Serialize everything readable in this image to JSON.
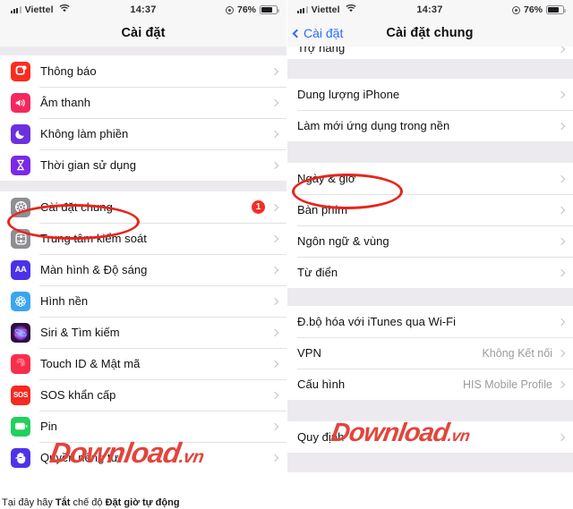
{
  "status_bar": {
    "carrier": "Viettel",
    "time": "14:37",
    "battery_percent": "76%",
    "wifi_icon": "wifi-icon",
    "signal_icon": "signal-bars-icon",
    "lock_icon": "rotation-lock-icon",
    "battery_icon": "battery-icon"
  },
  "left_phone": {
    "nav": {
      "title": "Cài đặt"
    },
    "groups": [
      {
        "rows": [
          {
            "label": "Thông báo",
            "icon": "notifications-icon",
            "icon_color": "#fb2c1f",
            "glyph": "notif"
          },
          {
            "label": "Âm thanh",
            "icon": "sounds-icon",
            "icon_color": "#f4285e",
            "glyph": "speaker"
          },
          {
            "label": "Không làm phiền",
            "icon": "do-not-disturb-icon",
            "icon_color": "#6c30e0",
            "glyph": "moon"
          },
          {
            "label": "Thời gian sử dụng",
            "icon": "screen-time-icon",
            "icon_color": "#7a29e6",
            "glyph": "hourglass"
          }
        ]
      },
      {
        "rows": [
          {
            "label": "Cài đặt chung",
            "icon": "general-gear-icon",
            "icon_color": "#8e8e93",
            "glyph": "gear",
            "badge": "1"
          },
          {
            "label": "Trung tâm kiểm soát",
            "icon": "control-center-icon",
            "icon_color": "#8e8e93",
            "glyph": "control"
          },
          {
            "label": "Màn hình & Độ sáng",
            "icon": "display-brightness-icon",
            "icon_color": "#4a32e8",
            "glyph": "aa"
          },
          {
            "label": "Hình nền",
            "icon": "wallpaper-icon",
            "icon_color": "#3aa6f0",
            "glyph": "flower"
          },
          {
            "label": "Siri & Tìm kiếm",
            "icon": "siri-search-icon",
            "icon_color": "#2b1240",
            "glyph": "siri"
          },
          {
            "label": "Touch ID & Mật mã",
            "icon": "touch-id-icon",
            "icon_color": "#fa2d4b",
            "glyph": "finger"
          },
          {
            "label": "SOS khẩn cấp",
            "icon": "emergency-sos-icon",
            "icon_color": "#f52a20",
            "glyph": "sos"
          },
          {
            "label": "Pin",
            "icon": "battery-settings-icon",
            "icon_color": "#20d15c",
            "glyph": "batt"
          },
          {
            "label": "Quyền riêng tư",
            "icon": "privacy-hand-icon",
            "icon_color": "#4c35e8",
            "glyph": "hand"
          }
        ]
      }
    ],
    "annotation": {
      "shape": "ellipse",
      "color": "#e8241b",
      "target": "Cài đặt chung"
    }
  },
  "right_phone": {
    "nav": {
      "back_label": "Cài đặt",
      "title": "Cài đặt chung"
    },
    "top_clipped_row": {
      "label": "Trợ năng"
    },
    "groups": [
      {
        "rows": [
          {
            "label": "Dung lượng iPhone"
          },
          {
            "label": "Làm mới ứng dụng trong nền"
          }
        ]
      },
      {
        "rows": [
          {
            "label": "Ngày & giờ"
          },
          {
            "label": "Bàn phím"
          },
          {
            "label": "Ngôn ngữ & vùng"
          },
          {
            "label": "Từ điển"
          }
        ]
      },
      {
        "rows": [
          {
            "label": "Đ.bộ hóa với iTunes qua Wi-Fi"
          },
          {
            "label": "VPN",
            "value": "Không Kết nối"
          },
          {
            "label": "Cấu hình",
            "value": "HIS Mobile Profile"
          }
        ]
      },
      {
        "rows": [
          {
            "label": "Quy định"
          }
        ]
      }
    ],
    "annotation": {
      "shape": "ellipse",
      "color": "#e8241b",
      "target": "Ngày & giờ"
    }
  },
  "watermarks": [
    {
      "text": "Download",
      "suffix": ".vn"
    },
    {
      "text": "Download",
      "suffix": ".vn"
    }
  ],
  "caption": {
    "prefix": "Tại đây hãy ",
    "bold1": "Tắt",
    "middle": " chế độ ",
    "bold2": "Đặt giờ tự động"
  }
}
